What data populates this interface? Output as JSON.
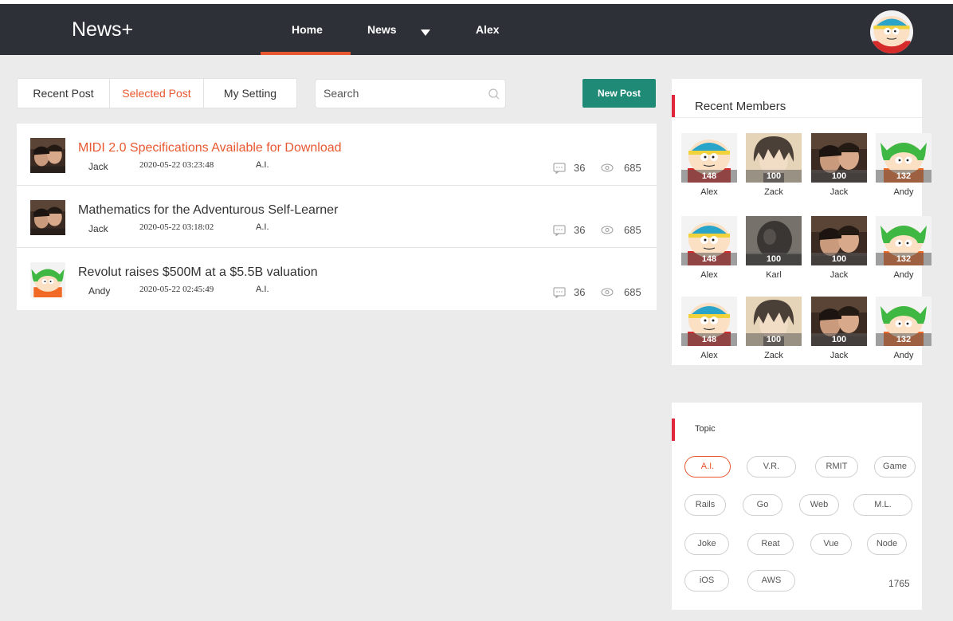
{
  "app": {
    "brand": "News+"
  },
  "nav": {
    "items": [
      {
        "label": "Home"
      },
      {
        "label": "News"
      },
      {
        "label": "Alex"
      }
    ]
  },
  "tabs": [
    {
      "label": "Recent Post"
    },
    {
      "label": "Selected Post"
    },
    {
      "label": "My Setting"
    }
  ],
  "search": {
    "placeholder": "Search",
    "value": ""
  },
  "new_post_label": "New Post",
  "posts": [
    {
      "title": "MIDI 2.0 Specifications Available for Download",
      "author": "Jack",
      "time": "2020-05-22 03:23:48",
      "tag": "A.I.",
      "comments": "36",
      "views": "685",
      "avatar": "photo-avatar"
    },
    {
      "title": "Mathematics for the Adventurous Self-Learner",
      "author": "Jack",
      "time": "2020-05-22 03:18:02",
      "tag": "A.I.",
      "comments": "36",
      "views": "685",
      "avatar": "photo-avatar"
    },
    {
      "title": "Revolut raises $500M at a $5.5B valuation",
      "author": "Andy",
      "time": "2020-05-22 02:45:49",
      "tag": "A.I.",
      "comments": "36",
      "views": "685",
      "avatar": "cartoon-green-hat-avatar"
    }
  ],
  "members": {
    "title": "Recent Members",
    "list": [
      {
        "name": "Alex",
        "count": "148",
        "avatar": "cartoon-cap-avatar"
      },
      {
        "name": "Zack",
        "count": "100",
        "avatar": "anime-avatar"
      },
      {
        "name": "Jack",
        "count": "100",
        "avatar": "photo-avatar"
      },
      {
        "name": "Andy",
        "count": "132",
        "avatar": "cartoon-green-hat-avatar"
      },
      {
        "name": "Alex",
        "count": "148",
        "avatar": "cartoon-cap-avatar"
      },
      {
        "name": "Karl",
        "count": "100",
        "avatar": "dark-photo-avatar"
      },
      {
        "name": "Jack",
        "count": "100",
        "avatar": "photo-avatar"
      },
      {
        "name": "Andy",
        "count": "132",
        "avatar": "cartoon-green-hat-avatar"
      },
      {
        "name": "Alex",
        "count": "148",
        "avatar": "cartoon-cap-avatar"
      },
      {
        "name": "Zack",
        "count": "100",
        "avatar": "anime-avatar"
      },
      {
        "name": "Jack",
        "count": "100",
        "avatar": "photo-avatar"
      },
      {
        "name": "Andy",
        "count": "132",
        "avatar": "cartoon-green-hat-avatar"
      }
    ]
  },
  "topics": {
    "title": "Topic",
    "list": [
      {
        "label": "A.I."
      },
      {
        "label": "V.R."
      },
      {
        "label": "RMIT"
      },
      {
        "label": "Game"
      },
      {
        "label": "Rails"
      },
      {
        "label": "Go"
      },
      {
        "label": "Web"
      },
      {
        "label": "M.L."
      },
      {
        "label": "Joke"
      },
      {
        "label": "Reat"
      },
      {
        "label": "Vue"
      },
      {
        "label": "Node"
      },
      {
        "label": "iOS"
      },
      {
        "label": "AWS"
      }
    ],
    "count": "1765"
  },
  "colors": {
    "accent": "#e8572f",
    "topbar": "#2e3038",
    "new_post": "#1f8a76",
    "panel_bar": "#e0263c"
  }
}
